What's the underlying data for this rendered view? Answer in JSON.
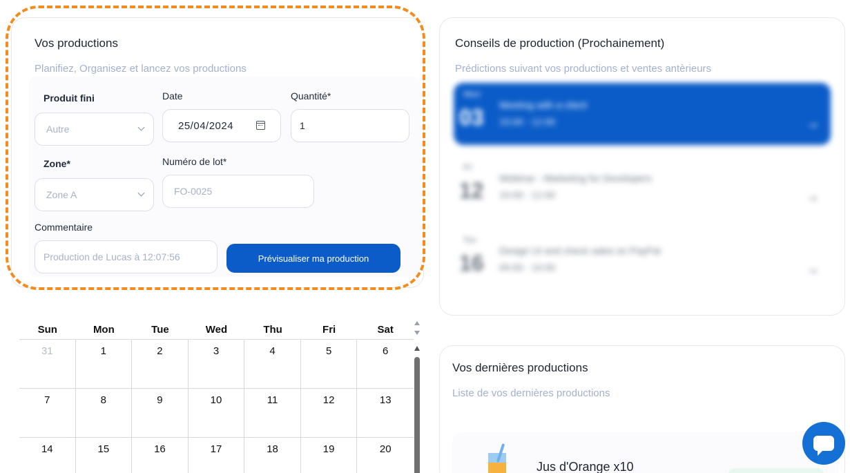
{
  "production_form": {
    "title": "Vos productions",
    "subtitle": "Planifiez, Organisez et lancez vos productions",
    "produit_label": "Produit fini",
    "produit_value": "Autre",
    "date_label": "Date",
    "date_value": "25/04/2024",
    "quantite_label": "Quantité*",
    "quantite_value": "1",
    "zone_label": "Zone*",
    "zone_value": "Zone A",
    "lot_label": "Numéro de lot*",
    "lot_placeholder": "FO-0025",
    "comment_label": "Commentaire",
    "comment_placeholder": "Production de Lucas à 12:07:56",
    "preview_button": "Prévisualiser ma production"
  },
  "advice": {
    "title": "Conseils de production (Prochainement)",
    "subtitle": "Prédictions suivant vos productions et ventes antèrieurs",
    "events": [
      {
        "dow": "Wed",
        "day": "03",
        "title": "Meeting with a client",
        "time": "10:00 - 12:00"
      },
      {
        "dow": "Fri",
        "day": "12",
        "title": "Webinar - Marketing for Developers",
        "time": "10:00 - 12:00"
      },
      {
        "dow": "Tue",
        "day": "16",
        "title": "Design UI and check sales on PayPal",
        "time": "09:00 - 10:00"
      }
    ]
  },
  "latest": {
    "title": "Vos dernières productions",
    "subtitle": "Liste de vos dernières productions",
    "items": [
      {
        "name": "Jus d'Orange x10"
      }
    ]
  },
  "calendar": {
    "weekdays": [
      "Sun",
      "Mon",
      "Tue",
      "Wed",
      "Thu",
      "Fri",
      "Sat"
    ],
    "weeks": [
      [
        {
          "d": "31",
          "other": true
        },
        {
          "d": "1"
        },
        {
          "d": "2"
        },
        {
          "d": "3"
        },
        {
          "d": "4"
        },
        {
          "d": "5"
        },
        {
          "d": "6"
        }
      ],
      [
        {
          "d": "7"
        },
        {
          "d": "8"
        },
        {
          "d": "9"
        },
        {
          "d": "10"
        },
        {
          "d": "11"
        },
        {
          "d": "12"
        },
        {
          "d": "13"
        }
      ],
      [
        {
          "d": "14"
        },
        {
          "d": "15"
        },
        {
          "d": "16"
        },
        {
          "d": "17"
        },
        {
          "d": "18"
        },
        {
          "d": "19"
        },
        {
          "d": "20"
        }
      ]
    ]
  },
  "colors": {
    "accent": "#0b5cc8",
    "highlight_outline": "#f28c1f",
    "chat": "#1570d6"
  },
  "icons": {
    "chat": "chat-bubble-icon",
    "calendar": "calendar-icon",
    "dropdown": "chevron-down-icon",
    "product": "orange-juice-icon"
  }
}
